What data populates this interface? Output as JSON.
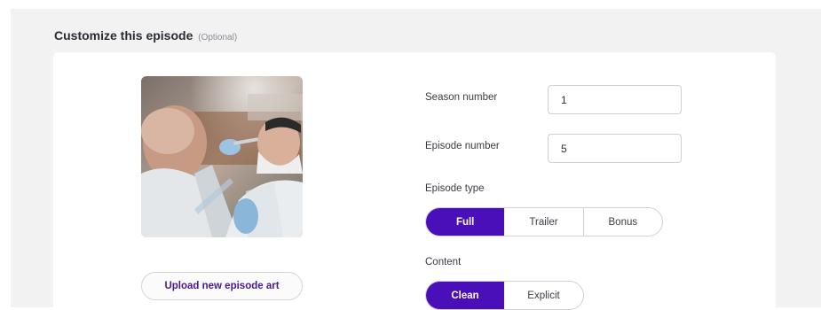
{
  "section": {
    "title": "Customize this episode",
    "optional_note": "(Optional)"
  },
  "artwork": {
    "icon": "episode-art-photo",
    "upload_label": "Upload new episode art"
  },
  "fields": {
    "season": {
      "label": "Season number",
      "value": "1"
    },
    "episode": {
      "label": "Episode number",
      "value": "5"
    }
  },
  "episode_type": {
    "label": "Episode type",
    "options": [
      "Full",
      "Trailer",
      "Bonus"
    ],
    "selected": "Full"
  },
  "content": {
    "label": "Content",
    "options": [
      "Clean",
      "Explicit"
    ],
    "selected": "Clean"
  },
  "colors": {
    "accent": "#4a0fb8",
    "upload_text": "#4a1a8a",
    "background": "#f2f2f3"
  }
}
